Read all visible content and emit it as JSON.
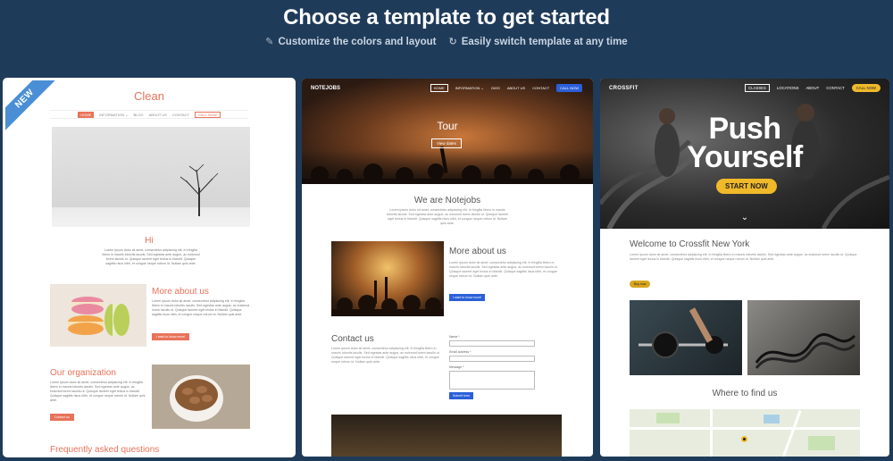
{
  "header": {
    "title": "Choose a template to get started",
    "feature1": "Customize the colors and layout",
    "feature2": "Easily switch template at any time",
    "feature1_icon": "pencil-icon",
    "feature2_icon": "sync-icon"
  },
  "colors": {
    "background": "#1f3b5a",
    "clean_accent": "#e8735a",
    "notejobs_accent": "#2b5fd9",
    "crossfit_accent": "#f0b92a",
    "ribbon": "#4a8fd6"
  },
  "clean": {
    "badge": "NEW",
    "brand": "Clean",
    "nav": [
      "HOME",
      "INFORMATION ⌄",
      "BLOG",
      "ABOUT US",
      "CONTACT"
    ],
    "call": "CALL NOW",
    "hi_title": "Hi",
    "hi_text": "Lorem ipsum dolor sit amet, consectetur adipiscing elit. In fringilla libero in mauris lobortis iaculis. Sed egestas ante augue, ac euismod lorem iaculis ut. Quisque laoreet eget lectus in blandit. Quisque sagittis risus nibh, et congue neque rutrum id. Nullam quis ante.",
    "more_title": "More about us",
    "more_text": "Lorem ipsum dolor sit amet, consectetur adipiscing elit. In fringilla libero in mauris lobortis iaculis. Sed egestas ante augue, ac euismod lorem iaculis ut. Quisque laoreet eget lectus in blandit. Quisque sagittis risus nibh, et congue neque rutrum id. Nullam quis ante.",
    "more_button": "I want to know more!",
    "org_title": "Our organization",
    "org_text": "Lorem ipsum dolor sit amet, consectetur adipiscing elit. In fringilla libero in mauris lobortis iaculis. Sed egestas ante augue, ac euismod lorem iaculis ut. Quisque laoreet eget lectus in blandit. Quisque sagittis risus nibh, et congue neque rutrum id. Nullam quis ante.",
    "org_button": "Contact us",
    "faq_title": "Frequently asked questions"
  },
  "notejobs": {
    "logo": "NOTEJOBS",
    "nav": [
      "HOME",
      "INFORMATION ⌄",
      "GIGS",
      "ABOUT US",
      "CONTACT"
    ],
    "call": "CALL NOW",
    "hero_title": "Tour",
    "hero_button": "View dates",
    "we_title": "We are Notejobs",
    "we_text": "Lorem ipsum dolor sit amet, consectetur adipiscing elit. In fringilla libero in mauris lobortis iaculis. Sed egestas ante augue, ac euismod lorem iaculis ut. Quisque laoreet eget lectus in blandit. Quisque sagittis risus nibh, et congue neque rutrum id. Nullam quis ante.",
    "more_title": "More about us",
    "more_text": "Lorem ipsum dolor sit amet, consectetur adipiscing elit. In fringilla libero in mauris lobortis iaculis. Sed egestas ante augue, ac euismod lorem iaculis ut. Quisque laoreet eget lectus in blandit. Quisque sagittis risus nibh, et congue neque rutrum id. Nullam quis ante.",
    "more_button": "I want to know more!",
    "contact_title": "Contact us",
    "contact_text": "Lorem ipsum dolor sit amet, consectetur adipiscing elit. In fringilla libero in mauris lobortis iaculis. Sed egestas ante augue, ac euismod lorem iaculis ut. Quisque laoreet eget lectus in blandit. Quisque sagittis risus nibh, et congue neque rutrum id. Nullam quis ante.",
    "form_name": "Name *",
    "form_email": "Email address *",
    "form_message": "Message *",
    "form_submit": "Submit form"
  },
  "crossfit": {
    "logo": "CROSSFIT",
    "nav": [
      "CLASSES",
      "LOCATIONS",
      "ABOUT",
      "CONTACT"
    ],
    "call": "CALL NOW",
    "hero_line1": "Push",
    "hero_line2": "Yourself",
    "hero_button": "START NOW",
    "welcome_title": "Welcome to Crossfit New York",
    "welcome_text": "Lorem ipsum dolor sit amet, consectetur adipiscing elit. In fringilla libero in mauris lobortis iaculis. Sed egestas ante augue, ac euismod lorem iaculis ut. Quisque laoreet eget lectus in blandit. Quisque sagittis risus nibh, et congue neque rutrum id. Nullam quis ante.",
    "welcome_button": "Buy now",
    "find_title": "Where to find us"
  }
}
